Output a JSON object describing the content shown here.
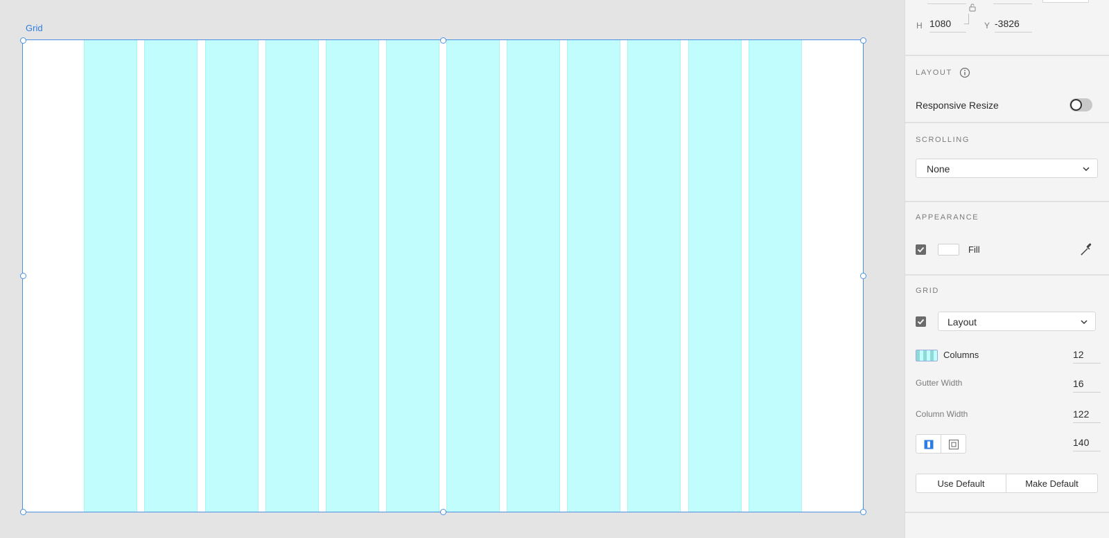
{
  "canvas": {
    "artboard_label": "Grid"
  },
  "inspector": {
    "dimensions": {
      "h_label": "H",
      "h_value": "1080",
      "y_label": "Y",
      "y_value": "-3826"
    },
    "layout": {
      "title": "LAYOUT",
      "responsive_resize_label": "Responsive Resize",
      "responsive_resize_on": false
    },
    "scrolling": {
      "title": "SCROLLING",
      "value": "None"
    },
    "appearance": {
      "title": "APPEARANCE",
      "fill_label": "Fill",
      "fill_checked": true,
      "fill_color": "#ffffff"
    },
    "grid": {
      "title": "GRID",
      "type_value": "Layout",
      "enabled": true,
      "columns_label": "Columns",
      "columns_value": "12",
      "gutter_label": "Gutter Width",
      "gutter_value": "16",
      "column_width_label": "Column Width",
      "column_width_value": "122",
      "margin_value": "140",
      "use_default_label": "Use Default",
      "make_default_label": "Make Default",
      "column_color": "#c2fdfd"
    }
  }
}
